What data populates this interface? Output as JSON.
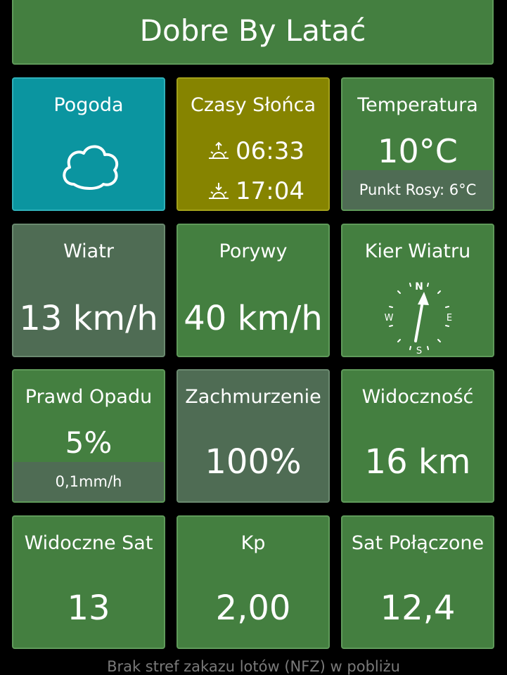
{
  "app": {
    "title": "Dobre By Latać"
  },
  "tiles": {
    "weather": {
      "title": "Pogoda",
      "icon": "cloud-icon"
    },
    "sun": {
      "title": "Czasy Słońca",
      "sunrise": "06:33",
      "sunset": "17:04"
    },
    "temperature": {
      "title": "Temperatura",
      "value": "10°C",
      "dew_point": "Punkt Rosy: 6°C"
    },
    "wind": {
      "title": "Wiatr",
      "value": "13 km/h"
    },
    "gusts": {
      "title": "Porywy",
      "value": "40 km/h"
    },
    "wind_direction": {
      "title": "Kier Wiatru",
      "n": "N",
      "e": "E",
      "s": "S",
      "w": "W"
    },
    "precipitation": {
      "title": "Prawd Opadu",
      "value": "5%",
      "amount": "0,1mm/h"
    },
    "cloud_cover": {
      "title": "Zachmurzenie",
      "value": "100%"
    },
    "visibility": {
      "title": "Widoczność",
      "value": "16 km"
    },
    "visible_sats": {
      "title": "Widoczne Sat",
      "value": "13"
    },
    "kp": {
      "title": "Kp",
      "value": "2,00"
    },
    "connected_sats": {
      "title": "Sat Połączone",
      "value": "12,4"
    }
  },
  "footer": {
    "text": "Brak stref zakazu lotów (NFZ) w pobliżu"
  },
  "colors": {
    "green": "#447f40",
    "gray": "#4f6c54",
    "teal": "#0b95a0",
    "olive": "#868400"
  }
}
